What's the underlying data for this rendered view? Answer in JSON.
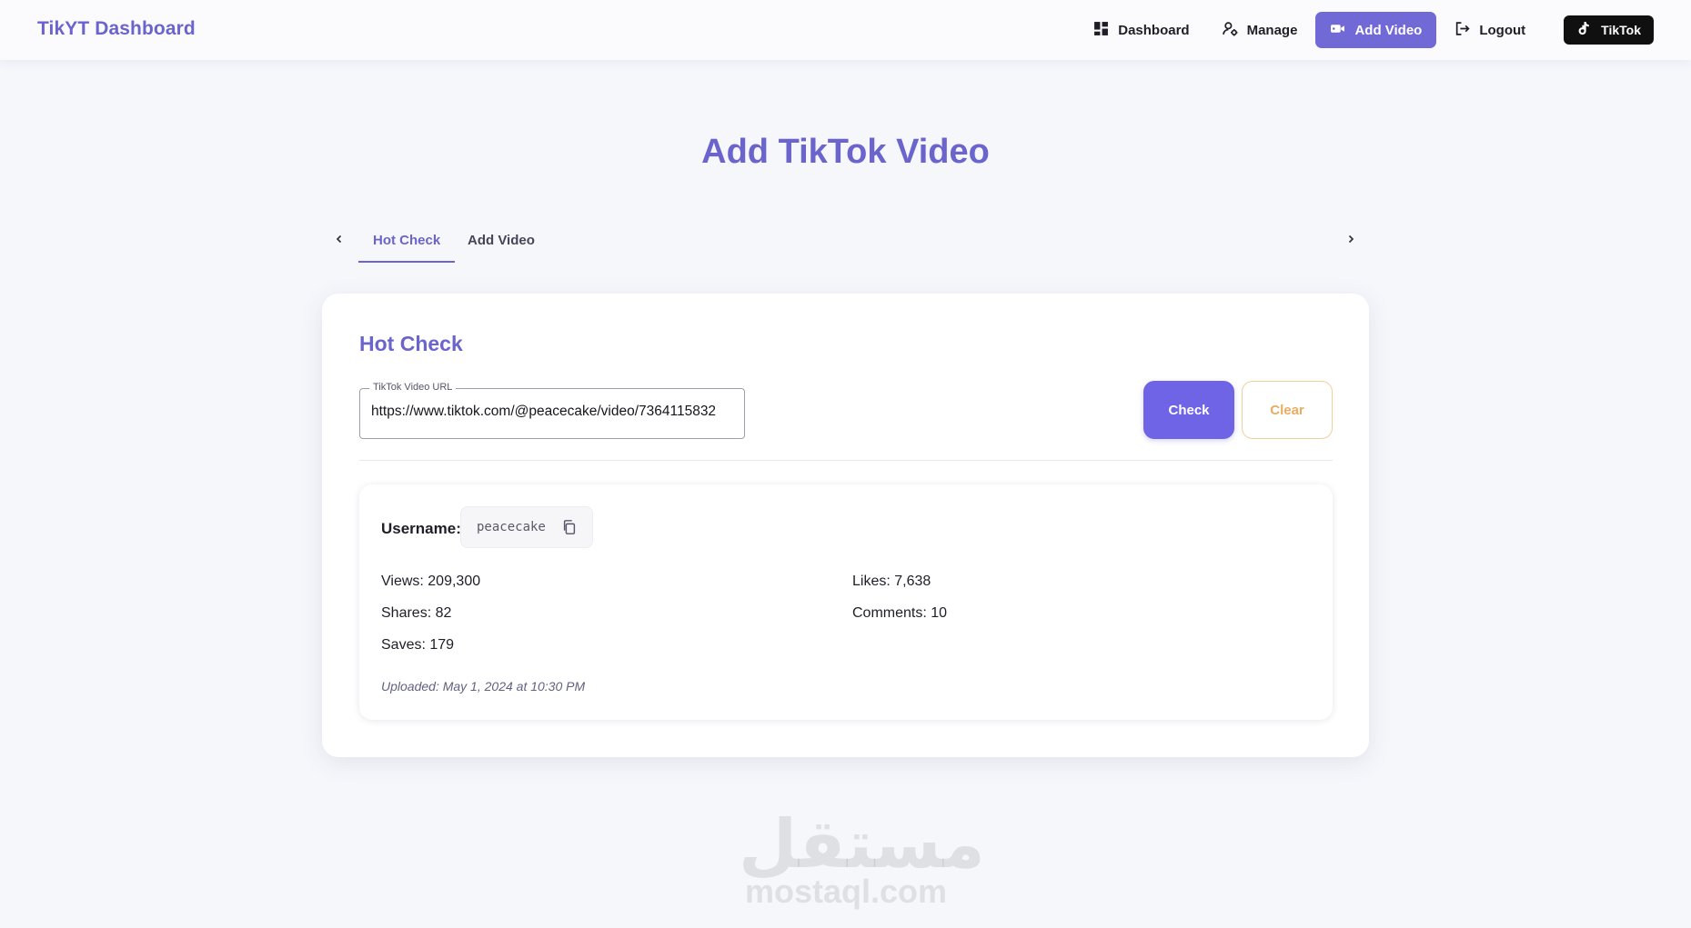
{
  "navbar": {
    "brand": "TikYT Dashboard",
    "items": [
      {
        "label": "Dashboard",
        "icon": "grid-icon"
      },
      {
        "label": "Manage",
        "icon": "user-gear-icon"
      },
      {
        "label": "Add Video",
        "icon": "video-camera-icon",
        "active": true
      },
      {
        "label": "Logout",
        "icon": "logout-icon"
      }
    ],
    "tiktok_label": "TikTok"
  },
  "page": {
    "title": "Add TikTok Video"
  },
  "tabs": {
    "items": [
      "Hot Check",
      "Add Video"
    ],
    "active": "Hot Check"
  },
  "hot_check": {
    "title": "Hot Check",
    "url_field": {
      "label": "TikTok Video URL",
      "value": "https://www.tiktok.com/@peacecake/video/7364115832"
    },
    "check_label": "Check",
    "clear_label": "Clear",
    "result": {
      "username_label": "Username:",
      "username": "peacecake",
      "views": "Views: 209,300",
      "likes": "Likes: 7,638",
      "shares": "Shares: 82",
      "comments": "Comments: 10",
      "saves": "Saves: 179",
      "uploaded": "Uploaded: May 1, 2024 at 10:30 PM"
    }
  },
  "watermark": {
    "arabic": "مستقل",
    "latin": "mostaql.com"
  },
  "colors": {
    "accent": "#6a64cc",
    "check_button": "#6f63e6",
    "clear_text": "#e8ad60",
    "tiktok_button": "#101010"
  }
}
